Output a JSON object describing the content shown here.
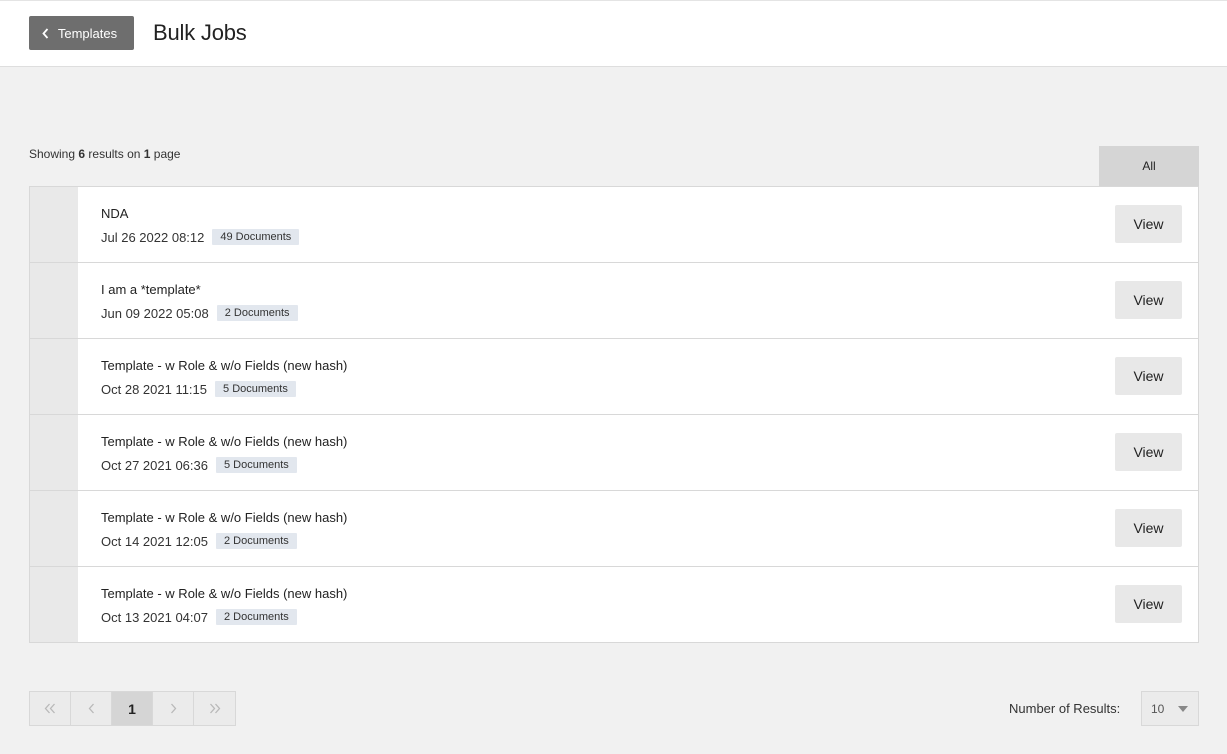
{
  "header": {
    "back_label": "Templates",
    "title": "Bulk Jobs"
  },
  "summary": {
    "prefix": "Showing ",
    "count": "6",
    "middle": " results on ",
    "pages": "1",
    "suffix": " page"
  },
  "filter": {
    "active_tab": "All"
  },
  "jobs": [
    {
      "title": "NDA",
      "date": "Jul 26 2022 08:12",
      "docs": "49 Documents",
      "action": "View"
    },
    {
      "title": "I am a *template*",
      "date": "Jun 09 2022 05:08",
      "docs": "2 Documents",
      "action": "View"
    },
    {
      "title": "Template - w Role & w/o Fields (new hash)",
      "date": "Oct 28 2021 11:15",
      "docs": "5 Documents",
      "action": "View"
    },
    {
      "title": "Template - w Role & w/o Fields (new hash)",
      "date": "Oct 27 2021 06:36",
      "docs": "5 Documents",
      "action": "View"
    },
    {
      "title": "Template - w Role & w/o Fields (new hash)",
      "date": "Oct 14 2021 12:05",
      "docs": "2 Documents",
      "action": "View"
    },
    {
      "title": "Template - w Role & w/o Fields (new hash)",
      "date": "Oct 13 2021 04:07",
      "docs": "2 Documents",
      "action": "View"
    }
  ],
  "pagination": {
    "current_page": "1",
    "icons": [
      "first-page-icon",
      "previous-page-icon",
      "next-page-icon",
      "last-page-icon"
    ]
  },
  "results_per_page": {
    "label": "Number of Results:",
    "value": "10"
  },
  "colors": {
    "back_button_bg": "#6e6e6e",
    "active_tab_bg": "#d5d5d5",
    "badge_bg": "#e2e7ee",
    "view_button_bg": "#e8e8e8"
  }
}
